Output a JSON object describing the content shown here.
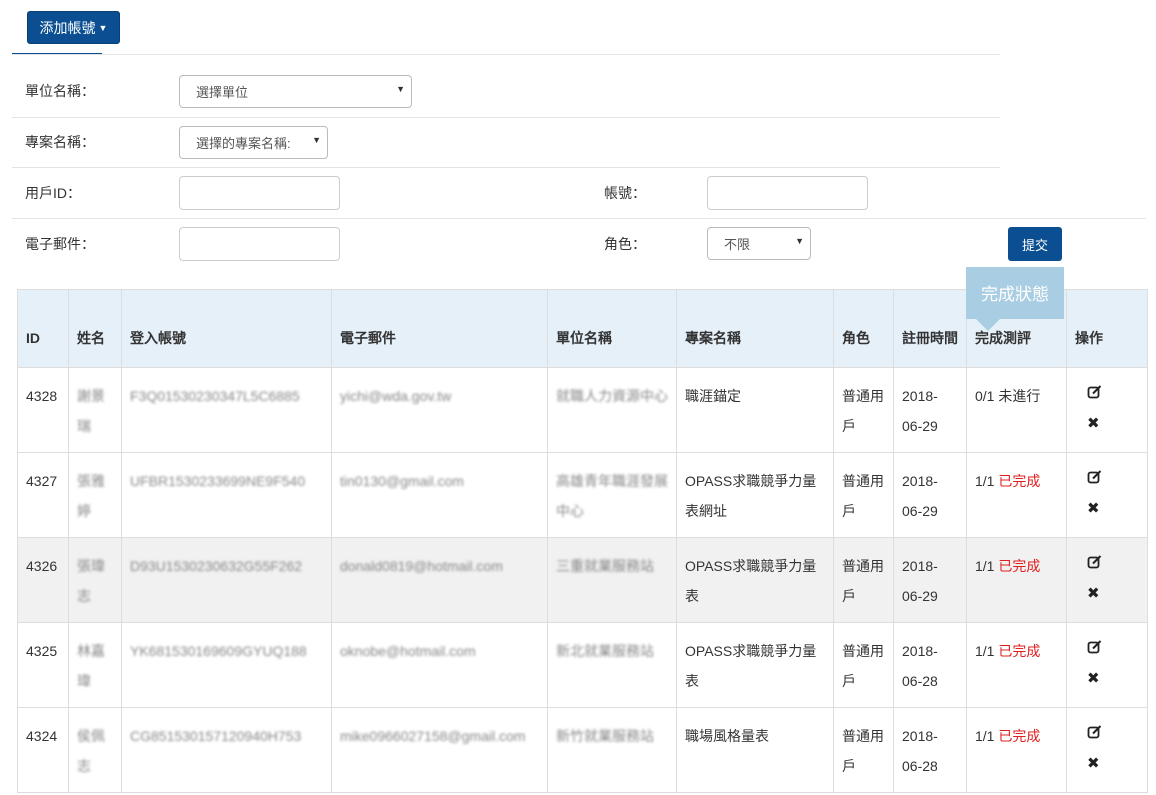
{
  "toolbar": {
    "add_label": "添加帳號"
  },
  "filters": {
    "unit_label": "單位名稱：",
    "unit_select": "選擇單位",
    "project_label": "專案名稱：",
    "project_select": "選擇的專案名稱:",
    "userid_label": "用戶ID：",
    "account_label": "帳號：",
    "email_label": "電子郵件：",
    "role_label": "角色：",
    "role_select": "不限",
    "submit_label": "提交"
  },
  "tooltip": {
    "text": "完成狀態"
  },
  "table": {
    "headers": [
      "ID",
      "姓名",
      "登入帳號",
      "電子郵件",
      "單位名稱",
      "專案名稱",
      "角色",
      "註冊時間",
      "完成測評",
      "操作"
    ],
    "rows": [
      {
        "id": "4328",
        "name": "謝景瑞",
        "login": "F3Q01530230347L5C6885",
        "email": "yichi@wda.gov.tw",
        "unit": "就職人力資源中心",
        "project": "職涯錨定",
        "role": "普通用戶",
        "reg_date": "2018-06-29",
        "score": "0/1",
        "status": "未進行"
      },
      {
        "id": "4327",
        "name": "張雅婷",
        "login": "UFBR1530233699NE9F540",
        "email": "tin0130@gmail.com",
        "unit": "高雄青年職涯發展中心",
        "project": "OPASS求職競爭力量表網址",
        "role": "普通用戶",
        "reg_date": "2018-06-29",
        "score": "1/1",
        "status": "已完成"
      },
      {
        "id": "4326",
        "name": "張瑋志",
        "login": "D93U1530230632G55F262",
        "email": "donald0819@hotmail.com",
        "unit": "三重就業服務站",
        "project": "OPASS求職競爭力量表",
        "role": "普通用戶",
        "reg_date": "2018-06-29",
        "score": "1/1",
        "status": "已完成"
      },
      {
        "id": "4325",
        "name": "林嘉瑋",
        "login": "YK681530169609GYUQ188",
        "email": "oknobe@hotmail.com",
        "unit": "新北就業服務站",
        "project": "OPASS求職競爭力量表",
        "role": "普通用戶",
        "reg_date": "2018-06-28",
        "score": "1/1",
        "status": "已完成"
      },
      {
        "id": "4324",
        "name": "侯佩志",
        "login": "CG851530157120940H753",
        "email": "mike0966027158@gmail.com",
        "unit": "新竹就業服務站",
        "project": "職場風格量表",
        "role": "普通用戶",
        "reg_date": "2018-06-28",
        "score": "1/1",
        "status": "已完成"
      }
    ]
  },
  "icons": {
    "edit": "edit-icon",
    "delete": "delete-icon",
    "caret": "caret-down-icon"
  },
  "colors": {
    "primary": "#0b4f92",
    "done": "#e02020",
    "header_bg": "#e6f0f9",
    "tooltip_bg": "#a9cde2"
  }
}
